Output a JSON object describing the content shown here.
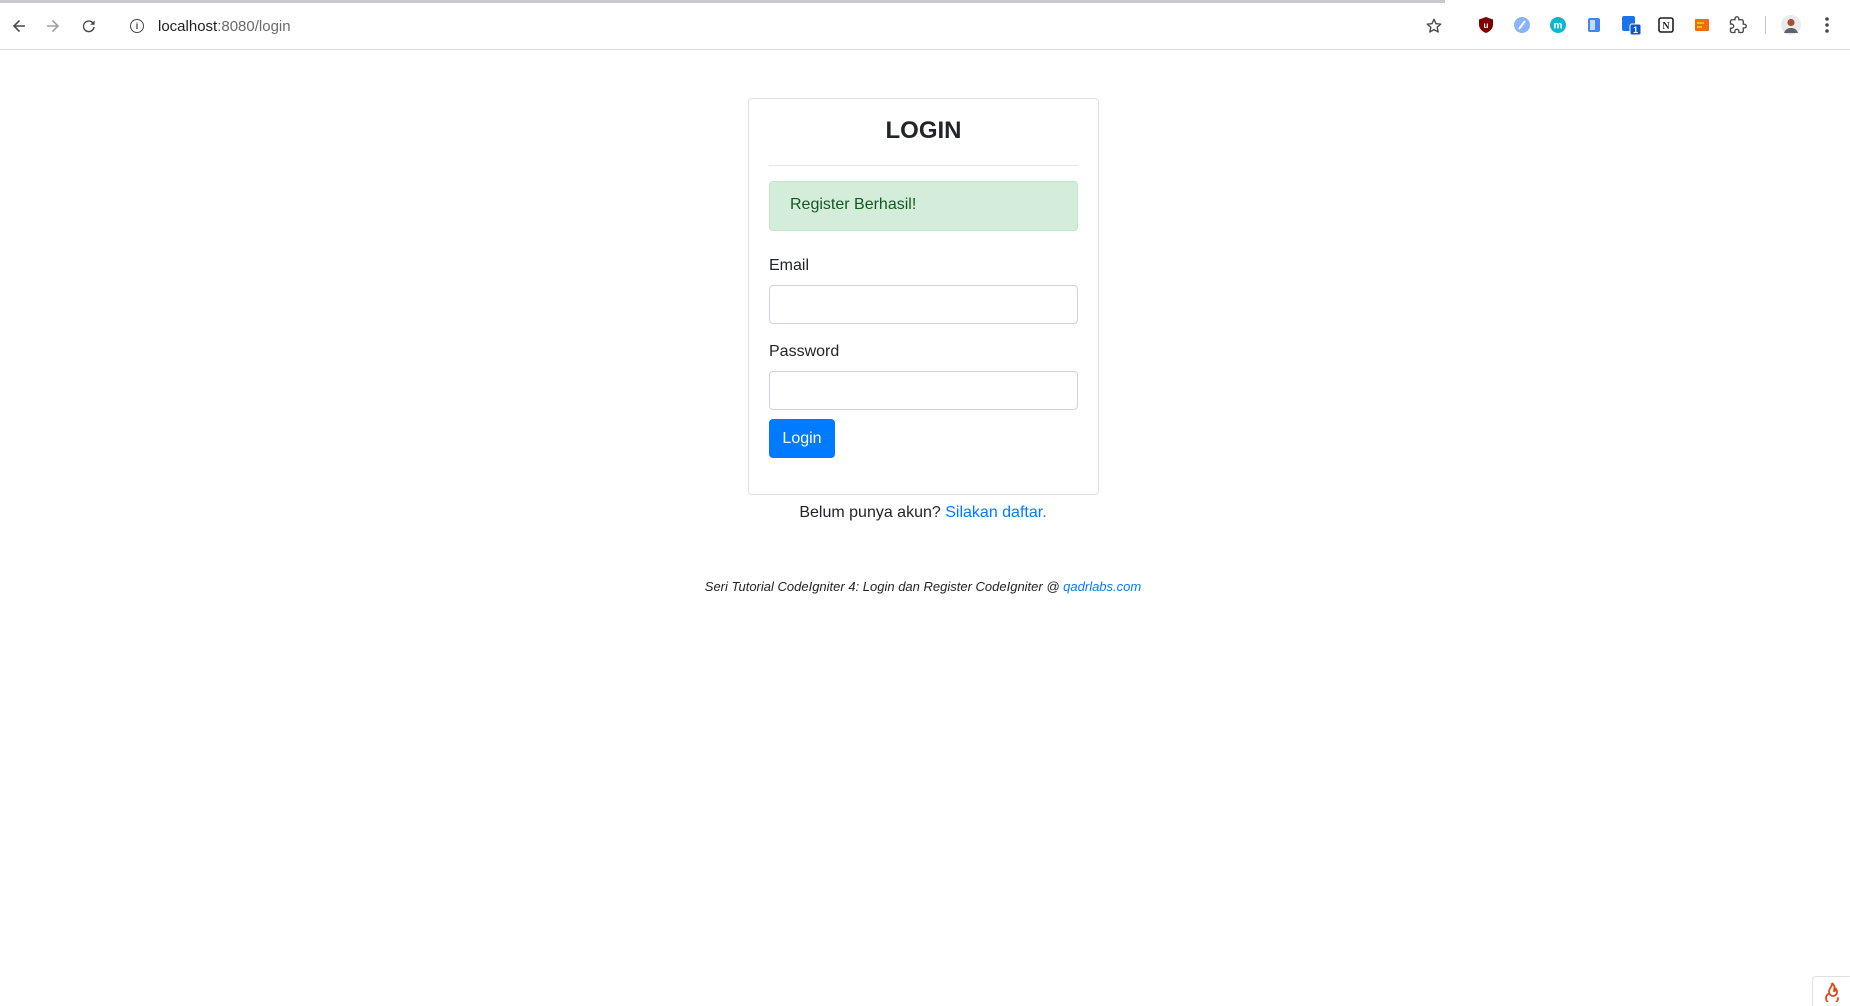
{
  "browser": {
    "url_host": "localhost",
    "url_path": ":8080/login",
    "nav": {
      "back_icon": "arrow-left-icon",
      "forward_icon": "arrow-right-icon",
      "reload_icon": "reload-icon"
    },
    "extensions": [
      {
        "name": "ublock-icon",
        "color": "#800000",
        "glyph": "u"
      },
      {
        "name": "feather-extension-icon",
        "color": "#8ab4f8",
        "glyph": "/"
      },
      {
        "name": "m-extension-icon",
        "color": "#12b5cb",
        "glyph": "m"
      },
      {
        "name": "document-extension-icon",
        "color": "#4285f4",
        "glyph": ""
      },
      {
        "name": "badge-extension-icon",
        "color": "#1a73e8",
        "glyph": "1"
      },
      {
        "name": "notion-extension-icon",
        "color": "#1f1f1f",
        "glyph": "N"
      },
      {
        "name": "orange-extension-icon",
        "color": "#e8710a",
        "glyph": ""
      },
      {
        "name": "puzzle-icon",
        "color": "#474747",
        "glyph": ""
      }
    ]
  },
  "login": {
    "title": "LOGIN",
    "alert": "Register Berhasil!",
    "email_label": "Email",
    "email_value": "",
    "password_label": "Password",
    "password_value": "",
    "button_label": "Login"
  },
  "register": {
    "prompt": "Belum punya akun?",
    "link": "Silakan daftar."
  },
  "footer": {
    "text": "Seri Tutorial CodeIgniter 4: Login dan Register CodeIgniter @",
    "link": "qadrlabs.com"
  },
  "colors": {
    "primary": "#007bff",
    "success_bg": "#d4edda",
    "success_text": "#155724"
  }
}
